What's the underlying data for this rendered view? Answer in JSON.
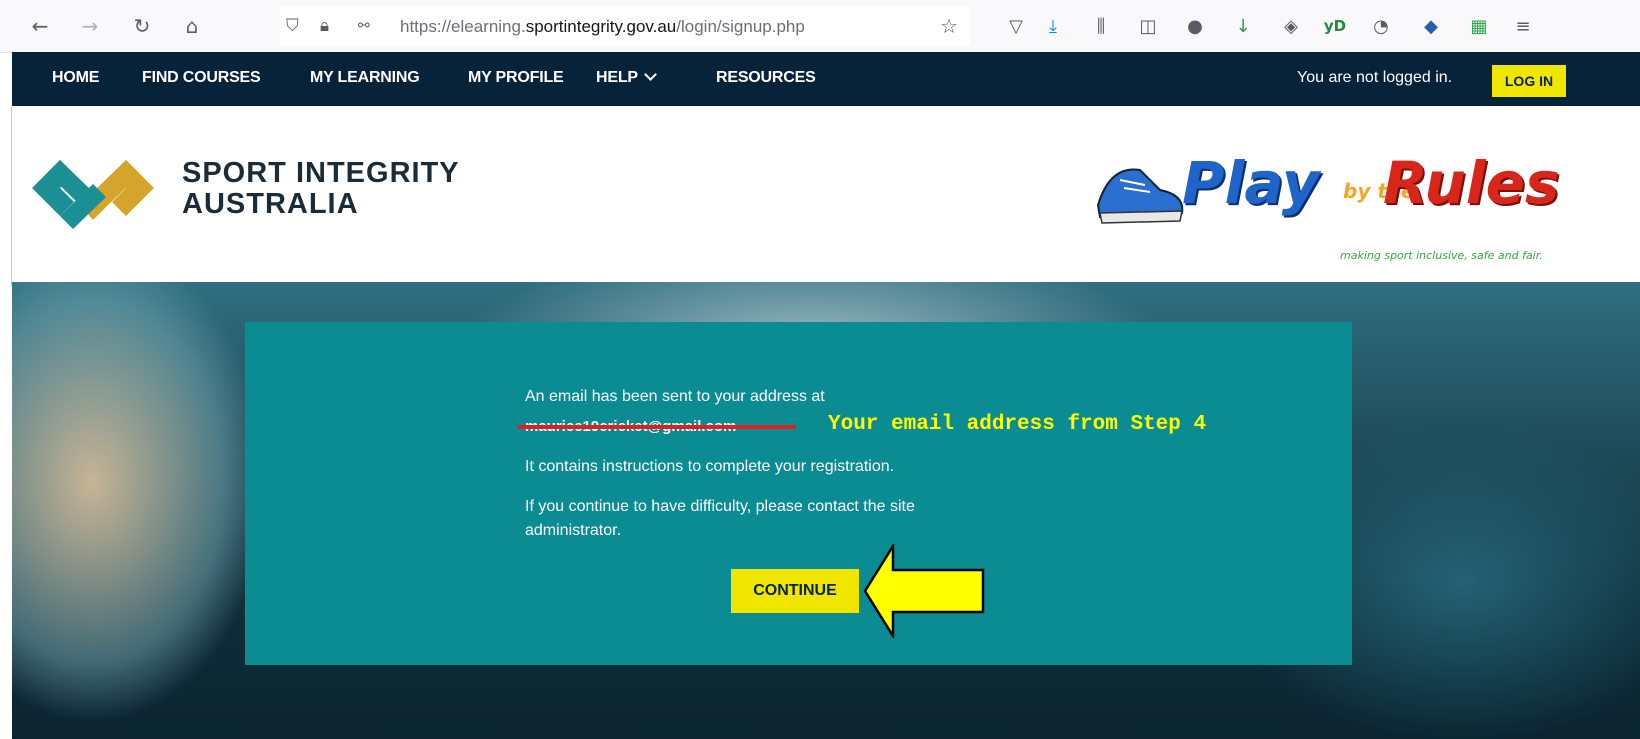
{
  "browser": {
    "url_prefix": "https://elearning.",
    "url_domain": "sportintegrity.gov.au",
    "url_path": "/login/signup.php",
    "toolbar_icons": [
      "pocket-icon",
      "download-icon",
      "library-icon",
      "sidebar-icon",
      "extension-icon",
      "download-arrow-icon",
      "extension-2-icon",
      "yd-icon",
      "sync-icon",
      "addon-icon",
      "sheet-icon",
      "menu-icon"
    ],
    "yd_label": "yD"
  },
  "nav": {
    "items": [
      {
        "label": "HOME"
      },
      {
        "label": "FIND COURSES"
      },
      {
        "label": "MY LEARNING"
      },
      {
        "label": "MY PROFILE"
      },
      {
        "label": "HELP"
      },
      {
        "label": "RESOURCES"
      }
    ],
    "status": "You are not logged in.",
    "login_label": "LOG IN"
  },
  "brand": {
    "line1": "SPORT INTEGRITY",
    "line2": "AUSTRALIA"
  },
  "partner": {
    "play": "Play",
    "by": "by the",
    "rules": "Rules",
    "tagline": "making sport inclusive, safe and fair."
  },
  "card": {
    "line1": "An email has been sent to your address at",
    "email": "maurice19cricket@gmail.com",
    "line2": "It contains instructions to complete your registration.",
    "line3": "If you continue to have difficulty, please contact the site",
    "line4": "administrator.",
    "continue_label": "CONTINUE"
  },
  "annotation": {
    "text": "Your email address from Step 4"
  },
  "colors": {
    "nav_bg": "#06233a",
    "accent_yellow": "#f1e600",
    "card_teal": "#0b8c92",
    "annotation_yellow": "#ffff00",
    "underline_red": "#e02020"
  }
}
